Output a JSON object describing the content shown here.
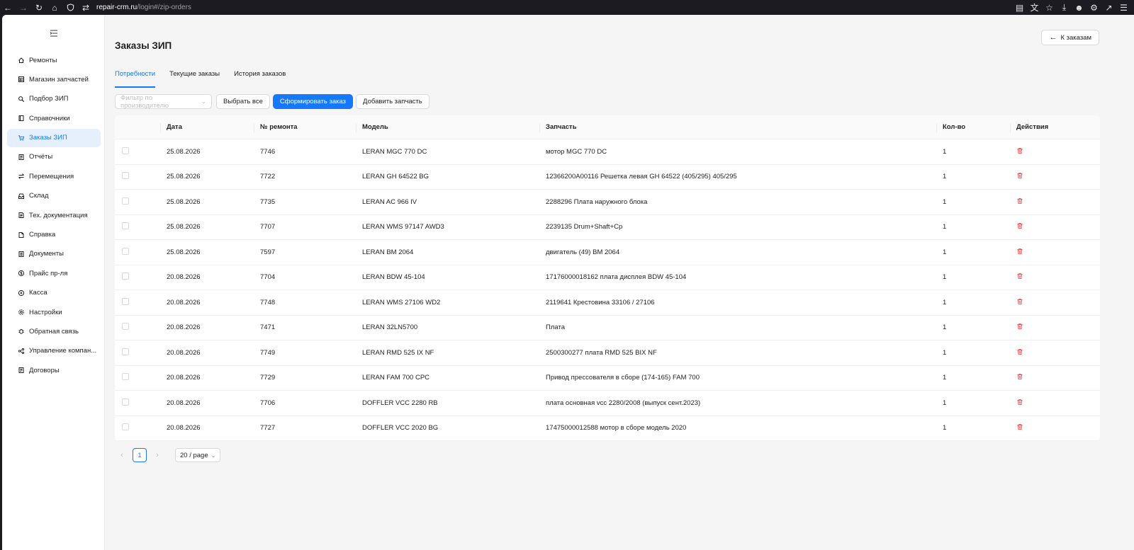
{
  "browser": {
    "url_host": "repair-crm.ru",
    "url_path": "/login#/zip-orders"
  },
  "sidebar": {
    "items": [
      {
        "label": "Ремонты",
        "icon": "home-icon"
      },
      {
        "label": "Магазин запчастей",
        "icon": "table-icon"
      },
      {
        "label": "Подбор ЗИП",
        "icon": "search-icon"
      },
      {
        "label": "Справочники",
        "icon": "book-icon"
      },
      {
        "label": "Заказы ЗИП",
        "icon": "cart-icon",
        "active": true
      },
      {
        "label": "Отчёты",
        "icon": "report-icon"
      },
      {
        "label": "Перемещения",
        "icon": "swap-icon"
      },
      {
        "label": "Склад",
        "icon": "inbox-icon"
      },
      {
        "label": "Тех. документация",
        "icon": "docs-icon"
      },
      {
        "label": "Справка",
        "icon": "help-doc-icon"
      },
      {
        "label": "Документы",
        "icon": "document-icon"
      },
      {
        "label": "Прайс пр-ля",
        "icon": "dollar-icon"
      },
      {
        "label": "Касса",
        "icon": "cash-icon"
      },
      {
        "label": "Настройки",
        "icon": "gear-icon"
      },
      {
        "label": "Обратная связь",
        "icon": "bug-icon"
      },
      {
        "label": "Управление компан...",
        "icon": "org-icon"
      },
      {
        "label": "Договоры",
        "icon": "contract-icon"
      }
    ]
  },
  "header": {
    "title": "Заказы ЗИП",
    "back_label": "К заказам"
  },
  "tabs": [
    {
      "label": "Потребности",
      "active": true
    },
    {
      "label": "Текущие заказы"
    },
    {
      "label": "История заказов"
    }
  ],
  "toolbar": {
    "filter_placeholder": "Фильтр по производителю",
    "select_all": "Выбрать все",
    "form_order": "Сформировать заказ",
    "add_part": "Добавить запчасть"
  },
  "table": {
    "columns": [
      "Дата",
      "№ ремонта",
      "Модель",
      "Запчасть",
      "Кол-во",
      "Действия"
    ],
    "rows": [
      {
        "date": "25.08.2026",
        "repair": "7746",
        "model": "LERAN MGC 770 DC",
        "part": "мотор MGC 770 DC",
        "qty": "1"
      },
      {
        "date": "25.08.2026",
        "repair": "7722",
        "model": "LERAN GH 64522 BG",
        "part": "12366200A00116 Решетка левая GH 64522 (405/295) 405/295",
        "qty": "1"
      },
      {
        "date": "25.08.2026",
        "repair": "7735",
        "model": "LERAN AC 966 IV",
        "part": "2288296 Плата наружного блока",
        "qty": "1"
      },
      {
        "date": "25.08.2026",
        "repair": "7707",
        "model": "LERAN WMS 97147 AWD3",
        "part": "2239135 Drum+Shaft+Cp",
        "qty": "1"
      },
      {
        "date": "25.08.2026",
        "repair": "7597",
        "model": "LERAN BM 2064",
        "part": "двигатель (49) BM 2064",
        "qty": "1"
      },
      {
        "date": "20.08.2026",
        "repair": "7704",
        "model": "LERAN BDW 45-104",
        "part": "17176000018162 плата дисплея BDW 45-104",
        "qty": "1"
      },
      {
        "date": "20.08.2026",
        "repair": "7748",
        "model": "LERAN WMS 27106 WD2",
        "part": "2119641 Крестовина 33106 / 27106",
        "qty": "1"
      },
      {
        "date": "20.08.2026",
        "repair": "7471",
        "model": "LERAN 32LN5700",
        "part": "Плата",
        "qty": "1"
      },
      {
        "date": "20.08.2026",
        "repair": "7749",
        "model": "LERAN RMD 525 IX NF",
        "part": "2500300277 плата RMD 525 BIX NF",
        "qty": "1"
      },
      {
        "date": "20.08.2026",
        "repair": "7729",
        "model": "LERAN FAM 700 CPC",
        "part": "Привод прессователя в сборе (174-165) FAM 700",
        "qty": "1"
      },
      {
        "date": "20.08.2026",
        "repair": "7706",
        "model": "DOFFLER VCC 2280 RB",
        "part": "плата основная vcc 2280/2008 (выпуск сент.2023)",
        "qty": "1"
      },
      {
        "date": "20.08.2026",
        "repair": "7727",
        "model": "DOFFLER VCC 2020 BG",
        "part": "17475000012588 мотор в сборе модель 2020",
        "qty": "1"
      }
    ]
  },
  "pagination": {
    "current": "1",
    "page_size": "20 / page"
  },
  "colors": {
    "accent": "#1677ff",
    "danger": "#ff4d4f",
    "active_bg": "#e6f0fd"
  }
}
